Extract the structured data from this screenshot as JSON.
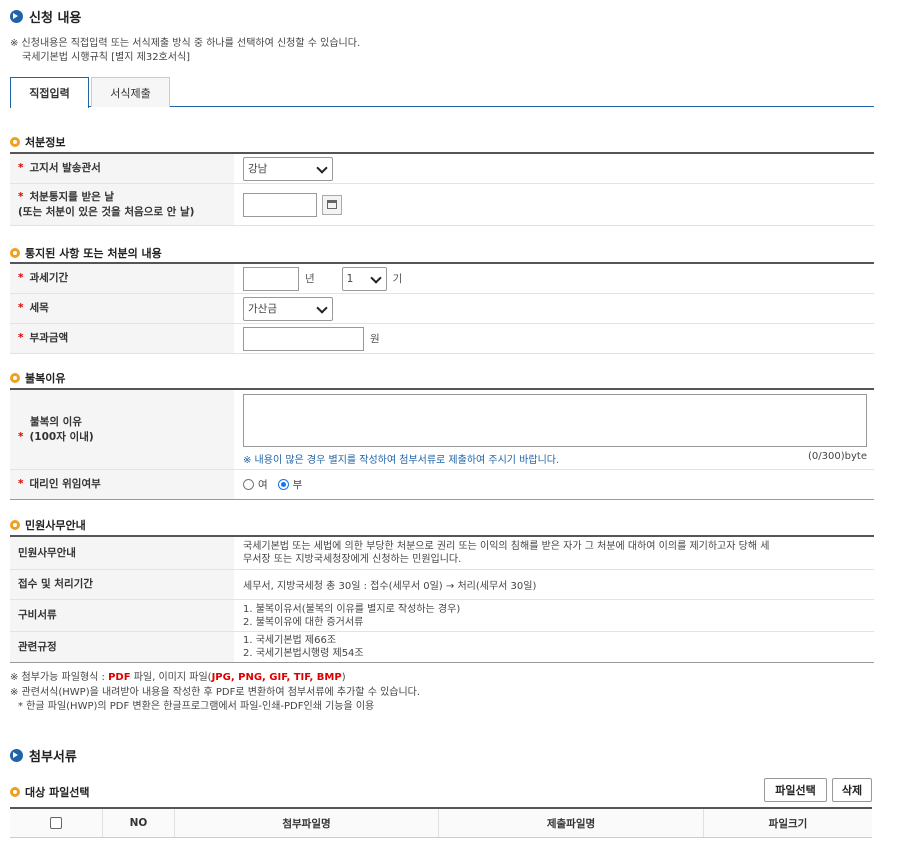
{
  "section_apply": {
    "title": "신청 내용",
    "note_line1": "※ 신청내용은 직접입력 또는 서식제출 방식 중 하나를 선택하여 신청할 수 있습니다.",
    "note_line2": "국세기본법 시행규칙 [별지 제32호서식]"
  },
  "tabs": [
    {
      "label": "직접입력",
      "active": true
    },
    {
      "label": "서식제출",
      "active": false
    }
  ],
  "disposition": {
    "title": "처분정보",
    "office_label": "고지서 발송관서",
    "office_value": "강남",
    "notice_date_label": "처분통지를 받은 날",
    "notice_date_sub": "(또는 처분이 있은 것을 처음으로 안 날)",
    "notice_date_value": ""
  },
  "notified": {
    "title": "통지된 사항 또는 처분의 내용",
    "period_label": "과세기간",
    "year_unit": "년",
    "term_value": "1",
    "term_unit": "기",
    "tax_label": "세목",
    "tax_value": "가산금",
    "amount_label": "부과금액",
    "amount_unit": "원"
  },
  "objection": {
    "title": "불복이유",
    "reason_label": "불복의 이유",
    "reason_sub": "(100자 이내)",
    "reason_hint": "※ 내용이 많은 경우 별지를 작성하여 첨부서류로 제출하여 주시기 바랍니다.",
    "reason_count": "(0/300)byte",
    "agent_label": "대리인 위임여부",
    "opt_yes": "여",
    "opt_no": "부"
  },
  "guide": {
    "title": "민원사무안내",
    "rows": [
      {
        "label": "민원사무안내",
        "lines": [
          "국세기본법 또는 세법에 의한 부당한 처분으로 권리 또는 이익의 침해를 받은 자가 그 처분에 대하여 이의를 제기하고자 당해 세",
          "무서장 또는 지방국세청장에게 신청하는 민원입니다."
        ]
      },
      {
        "label": "접수 및 처리기간",
        "lines": [
          "세무서, 지방국세청 총 30일 : 접수(세무서 0일) → 처리(세무서 30일)"
        ]
      },
      {
        "label": "구비서류",
        "lines": [
          "1. 불복이유서(불복의 이유를 별지로 작성하는 경우)",
          "2. 불복이유에 대한 증거서류"
        ]
      },
      {
        "label": "관련규정",
        "lines": [
          "1. 국세기본법 제66조",
          "2. 국세기본법시행령 제54조"
        ]
      }
    ]
  },
  "footnotes": {
    "f1_prefix": "※ 첨부가능 파일형식 : ",
    "f1_pdf": "PDF",
    "f1_mid": " 파일, 이미지 파일(",
    "f1_img": "JPG, PNG, GIF, TIF, BMP",
    "f1_end": ")",
    "f2": "※ 관련서식(HWP)을 내려받아 내용을 작성한 후 PDF로 변환하여 첨부서류에 추가할 수 있습니다.",
    "f3": "* 한글 파일(HWP)의 PDF 변환은 한글프로그램에서 파일-인쇄-PDF인쇄 기능을 이용"
  },
  "attach": {
    "title": "첨부서류",
    "sub_title": "대상 파일선택",
    "select_btn": "파일선택",
    "delete_btn": "삭제",
    "columns": [
      "NO",
      "첨부파일명",
      "제출파일명",
      "파일크기"
    ]
  },
  "colors": {
    "accent": "#1f63a8",
    "required": "#dd0000",
    "bullet": "#f0a020"
  }
}
